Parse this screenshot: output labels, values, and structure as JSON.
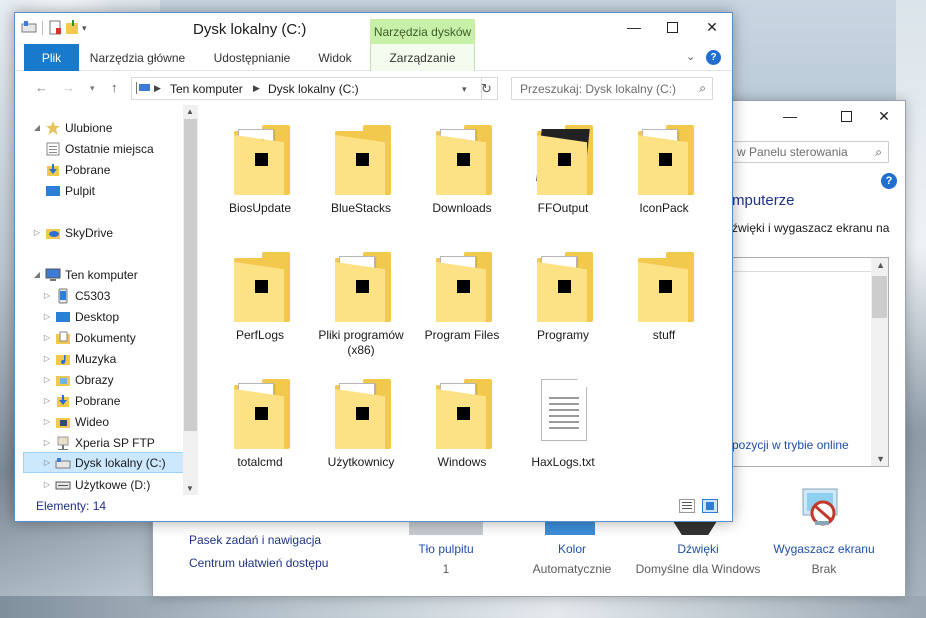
{
  "explorer": {
    "title": "Dysk lokalny (C:)",
    "context_group": "Narzędzia dysków",
    "ribbon_tabs": [
      "Plik",
      "Narzędzia główne",
      "Udostępnianie",
      "Widok",
      "Zarządzanie"
    ],
    "help": "?",
    "address": {
      "segments": [
        "Ten komputer",
        "Dysk lokalny (C:)"
      ]
    },
    "search_placeholder": "Przeszukaj: Dysk lokalny (C:)",
    "nav": {
      "favorites": "Ulubione",
      "favorites_items": [
        "Ostatnie miejsca",
        "Pobrane",
        "Pulpit"
      ],
      "skydrive": "SkyDrive",
      "computer": "Ten komputer",
      "computer_items": [
        "C5303",
        "Desktop",
        "Dokumenty",
        "Muzyka",
        "Obrazy",
        "Pobrane",
        "Wideo",
        "Xperia SP FTP",
        "Dysk lokalny (C:)",
        "Użytkowe (D:)"
      ]
    },
    "items": [
      {
        "name": "BiosUpdate",
        "kind": "folder-app"
      },
      {
        "name": "BlueStacks",
        "kind": "folder"
      },
      {
        "name": "Downloads",
        "kind": "folder-doc"
      },
      {
        "name": "FFOutput",
        "kind": "folder-dark"
      },
      {
        "name": "IconPack",
        "kind": "folder-doc"
      },
      {
        "name": "PerfLogs",
        "kind": "folder"
      },
      {
        "name": "Pliki programów (x86)",
        "kind": "folder-doc"
      },
      {
        "name": "Program Files",
        "kind": "folder-doc"
      },
      {
        "name": "Programy",
        "kind": "folder-doc"
      },
      {
        "name": "stuff",
        "kind": "folder"
      },
      {
        "name": "totalcmd",
        "kind": "folder-gear"
      },
      {
        "name": "Użytkownicy",
        "kind": "folder-doc"
      },
      {
        "name": "Windows",
        "kind": "folder-doc"
      },
      {
        "name": "HaxLogs.txt",
        "kind": "text-file"
      }
    ],
    "status": "Elementy: 14"
  },
  "control_panel": {
    "search_placeholder": "w Panelu sterowania",
    "help": "?",
    "heading": "mputerze",
    "description": "źwięki i wygaszacz ekranu na",
    "online_link": "pozycji w trybie online",
    "left_links": [
      "Pasek zadań i nawigacja",
      "Centrum ułatwień dostępu"
    ],
    "gallery": [
      {
        "label": "Tło pulpitu",
        "sub": "1"
      },
      {
        "label": "Kolor",
        "sub": "Automatycznie"
      },
      {
        "label": "Dźwięki",
        "sub": "Domyślne dla Windows"
      },
      {
        "label": "Wygaszacz ekranu",
        "sub": "Brak"
      }
    ]
  },
  "colors": {
    "accent": "#1979ca",
    "folder": "#f2c94c",
    "folder_front": "#fde185",
    "link": "#1e3287",
    "selection": "#cce8ff",
    "context_tab": "#c9f0a8"
  }
}
